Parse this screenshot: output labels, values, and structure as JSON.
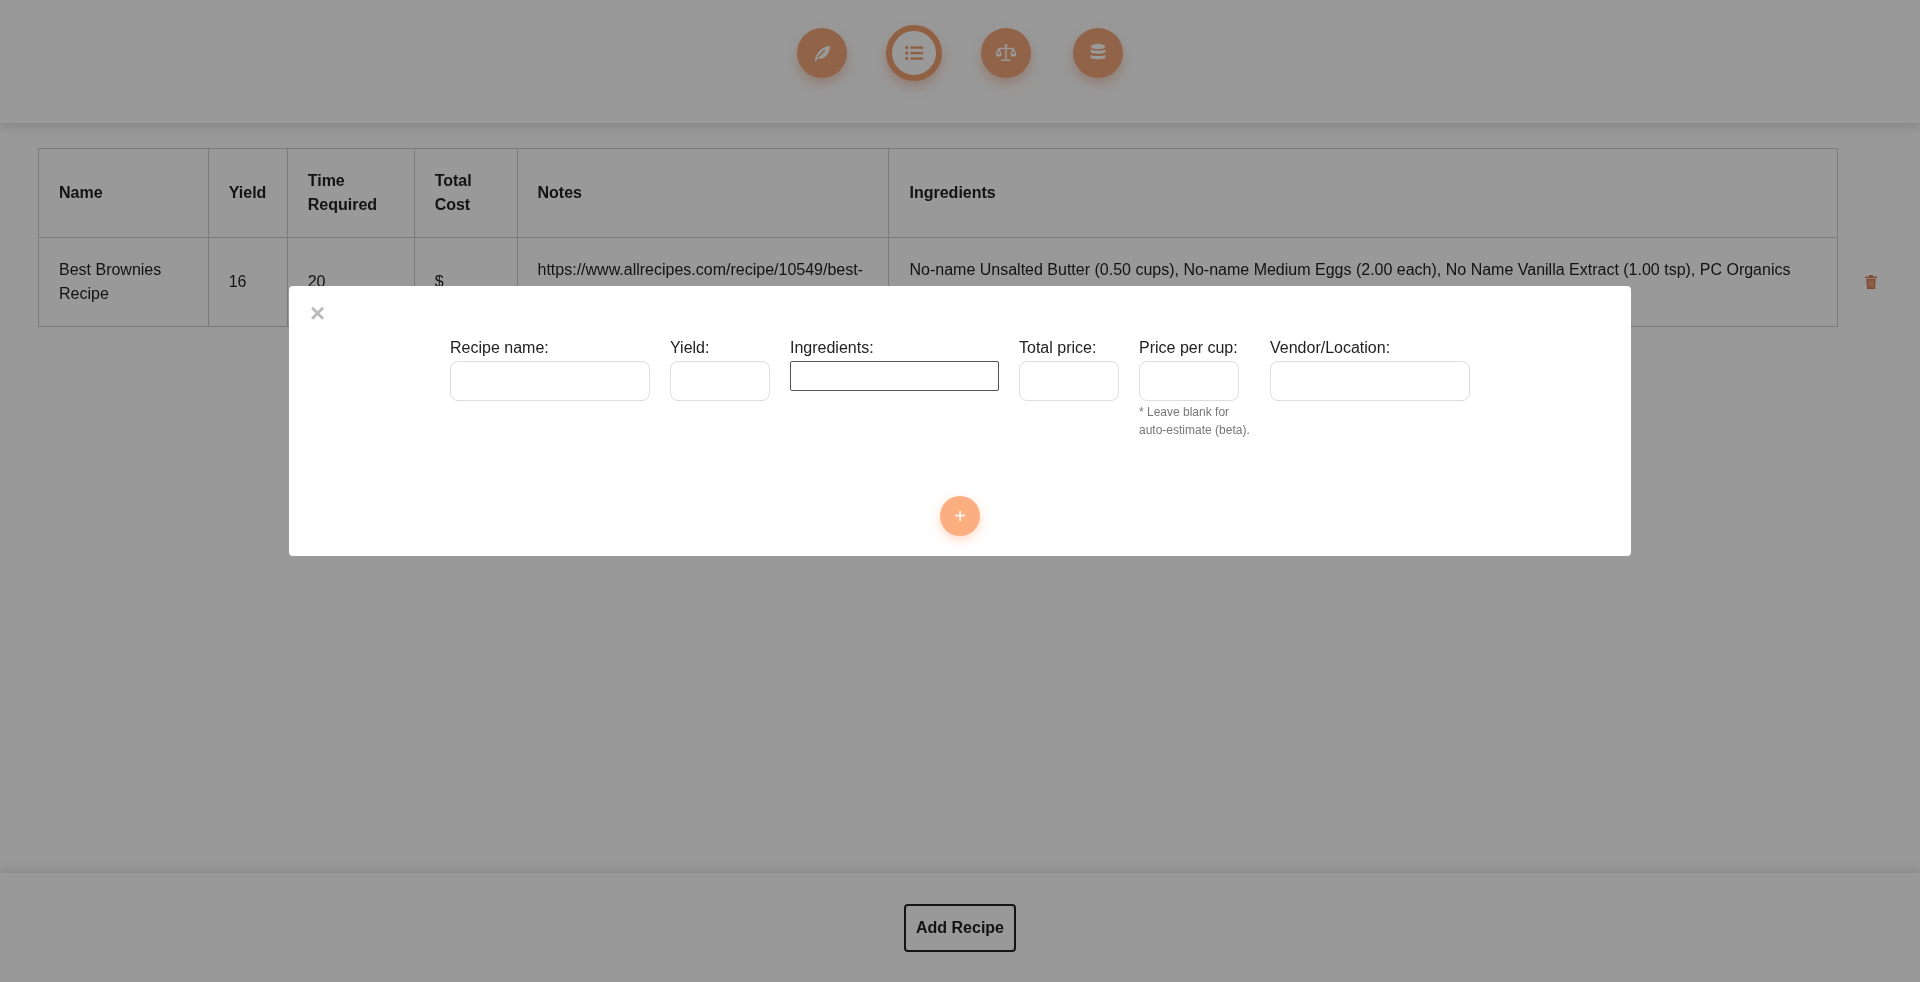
{
  "nav": [
    {
      "kind": "leaf",
      "selected": false
    },
    {
      "kind": "list",
      "selected": true
    },
    {
      "kind": "scale",
      "selected": false
    },
    {
      "kind": "database",
      "selected": false
    }
  ],
  "table": {
    "columns": [
      "Name",
      "Yield",
      "Time Required",
      "Total Cost",
      "Notes",
      "Ingredients"
    ],
    "rows": [
      {
        "cells": [
          "Best Brownies Recipe",
          "16",
          "20",
          "$",
          "https://www.allrecipes.com/recipe/10549/best-",
          "No-name Unsalted Butter (0.50 cups), No-name Medium Eggs (2.00 each), No Name Vanilla Extract (1.00 tsp), PC Organics"
        ]
      }
    ]
  },
  "modal": {
    "close": "×",
    "fields": [
      {
        "label": "Recipe name:",
        "kind": "wide"
      },
      {
        "label": "Yield:",
        "kind": "narrow"
      },
      {
        "label": "Ingredients:",
        "kind": "plain"
      },
      {
        "label": "Total price:",
        "kind": "narrow"
      },
      {
        "label": "Price per cup:",
        "kind": "narrow",
        "hint": "* Leave blank for auto-estimate (beta)."
      },
      {
        "label": "Vendor/Location:",
        "kind": "wide"
      }
    ],
    "add_button": "+"
  },
  "footer": {
    "button": "Add Recipe"
  }
}
